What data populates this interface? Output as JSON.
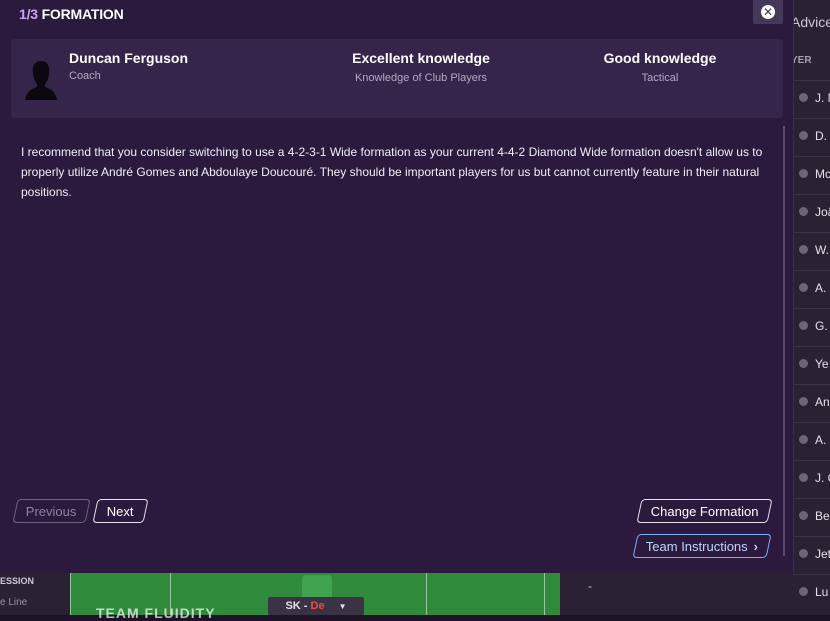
{
  "modal": {
    "step": "1/3",
    "title": "FORMATION"
  },
  "coach": {
    "name": "Duncan Ferguson",
    "role": "Coach",
    "knowledge": [
      {
        "title": "Excellent knowledge",
        "subtitle": "Knowledge of Club Players"
      },
      {
        "title": "Good knowledge",
        "subtitle": "Tactical"
      }
    ]
  },
  "advice": {
    "text": "I recommend that you consider switching to use a 4-2-3-1 Wide formation as your current 4-4-2 Diamond Wide formation doesn't allow us to properly utilize André Gomes and Abdoulaye Doucouré. They should be important players for us but cannot currently feature in their natural positions."
  },
  "buttons": {
    "previous": "Previous",
    "next": "Next",
    "change_formation": "Change Formation",
    "team_instructions": "Team Instructions"
  },
  "background": {
    "advice_tab": "Advice",
    "player_col": "YER",
    "rows": [
      "J. N",
      "D. C",
      "Mc",
      "Joã",
      "W.",
      "A.",
      "G.",
      "Ye",
      "An",
      "A.",
      "J. C",
      "Be",
      "Jet",
      "Lu"
    ],
    "left_label_1": "ESSION",
    "left_label_2": "e Line",
    "pitch_label": "TEAM FLUIDITY",
    "position": "SK",
    "role": "De",
    "dash": "-"
  }
}
